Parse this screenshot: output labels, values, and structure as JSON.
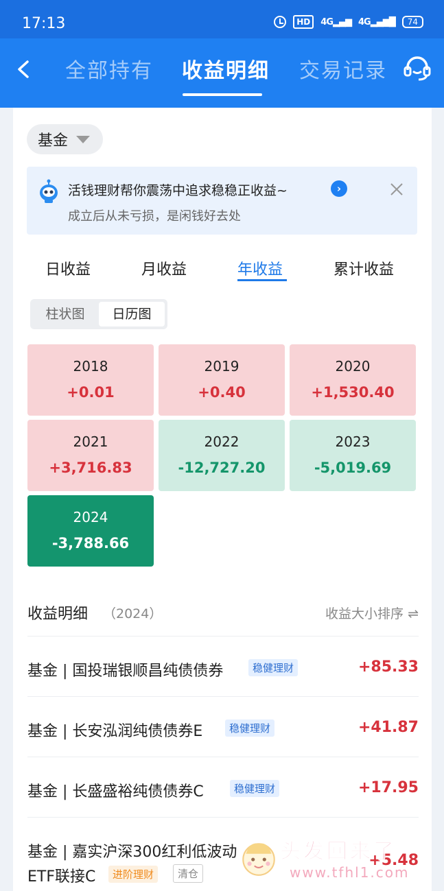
{
  "status_bar": {
    "time": "17:13",
    "hd": "HD",
    "net1": "4G",
    "net2": "4G",
    "battery": "74"
  },
  "nav": {
    "tabs": [
      "全部持有",
      "收益明细",
      "交易记录"
    ],
    "active_tab": "收益明细"
  },
  "filter": {
    "selected": "基金"
  },
  "banner": {
    "title": "活钱理财帮你震荡中追求稳稳正收益~",
    "subtitle": "成立后从未亏损，是闲钱好去处"
  },
  "period_tabs": [
    "日收益",
    "月收益",
    "年收益",
    "累计收益"
  ],
  "view_toggle": [
    "柱状图",
    "日历图"
  ],
  "calendar": [
    {
      "year": "2018",
      "value": "+0.01"
    },
    {
      "year": "2019",
      "value": "+0.40"
    },
    {
      "year": "2020",
      "value": "+1,530.40"
    },
    {
      "year": "2021",
      "value": "+3,716.83"
    },
    {
      "year": "2022",
      "value": "-12,727.20"
    },
    {
      "year": "2023",
      "value": "-5,019.69"
    },
    {
      "year": "2024",
      "value": "-3,788.66"
    }
  ],
  "detail": {
    "title": "收益明细",
    "year": "（2024）",
    "sort": "收益大小排序 ⇌",
    "rows": [
      {
        "name": "基金 | 国投瑞银顺昌纯债债券",
        "tag": "稳健理财",
        "amount": "+85.33"
      },
      {
        "name": "基金 | 长安泓润纯债债券E",
        "tag": "稳健理财",
        "amount": "+41.87"
      },
      {
        "name": "基金 | 长盛盛裕纯债债券C",
        "tag": "稳健理财",
        "amount": "+17.95"
      },
      {
        "name": "基金 | 嘉实沪深300红利低波动",
        "name2": "ETF联接C",
        "tag": "进阶理财",
        "tag2": "清仓",
        "amount": "+5.48"
      }
    ]
  },
  "watermark": {
    "text": "头发回来了",
    "url": "www.tfhl1.com"
  },
  "colors": {
    "header_blue": "#1f80f2",
    "positive": "#d7323c",
    "negative": "#14956a",
    "selected_cell": "#14956e"
  }
}
